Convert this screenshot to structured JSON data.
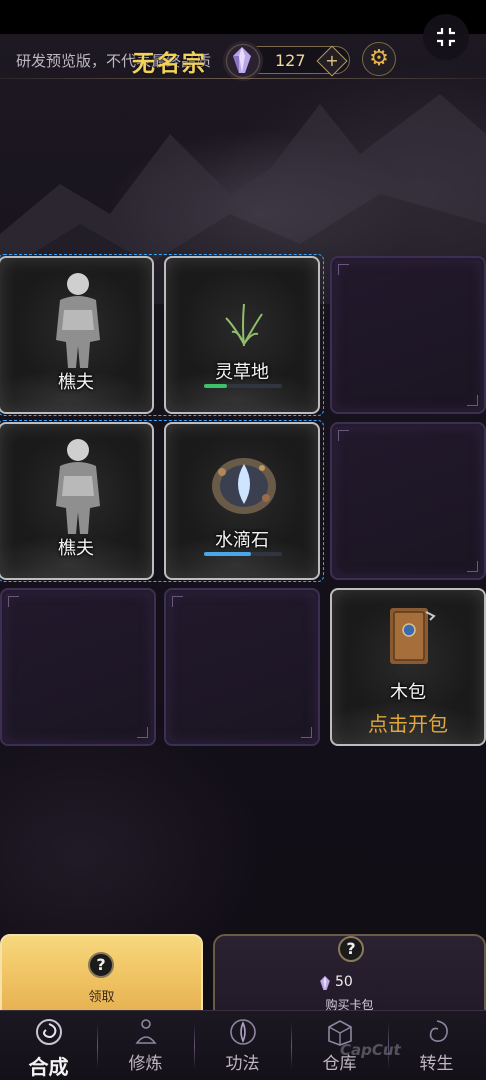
{
  "header": {
    "notice": "研发预览版，不代表最终品质",
    "sect_name": "无名宗",
    "gem_count": "127",
    "plus_label": "+",
    "settings_icon": "gear-icon",
    "exit_fullscreen_icon": "collapse-icon"
  },
  "board": {
    "cards": [
      {
        "name": "樵夫",
        "icon": "woodcutter-figure"
      },
      {
        "name": "灵草地",
        "icon": "spirit-herb",
        "progress": 0.3,
        "progress_color": "#3fc06a"
      },
      {
        "name": "樵夫",
        "icon": "woodcutter-figure"
      },
      {
        "name": "水滴石",
        "icon": "water-drop-stone",
        "progress": 0.6,
        "progress_color": "#4aa6ea"
      },
      {
        "name": "木包",
        "icon": "card-pack",
        "action": "点击开包"
      }
    ]
  },
  "claim": {
    "label": "领取",
    "icon": "question-icon"
  },
  "buy_pack": {
    "price": "50",
    "label": "购买卡包",
    "icon": "question-icon"
  },
  "nav": [
    {
      "label": "合成",
      "icon": "vortex-icon",
      "active": true
    },
    {
      "label": "修炼",
      "icon": "meditate-icon",
      "active": false
    },
    {
      "label": "功法",
      "icon": "lotus-icon",
      "active": false
    },
    {
      "label": "仓库",
      "icon": "chest-icon",
      "active": false
    },
    {
      "label": "转生",
      "icon": "swirl-icon",
      "active": false
    }
  ],
  "colors": {
    "gold": "#f3d25a",
    "open_pack": "#e0a83a",
    "grid_outline": "#39a4ff"
  }
}
